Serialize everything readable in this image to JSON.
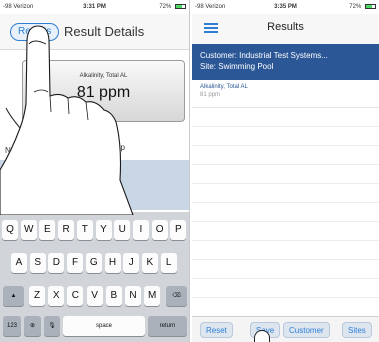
{
  "left": {
    "status": {
      "carrier": "-98 Verizon",
      "time": "3:31 PM",
      "battery": "72%",
      "battery_level": 0.72
    },
    "nav": {
      "back_label": "Results",
      "title": "Result Details"
    },
    "result": {
      "parameter": "Alkalinity, Total AL",
      "value": "81 ppm"
    },
    "input_method": "Input Method: iDip",
    "notes_label_fragment": "N",
    "keyboard": {
      "row1": [
        "Q",
        "W",
        "E",
        "R",
        "T",
        "Y",
        "U",
        "I",
        "O",
        "P"
      ],
      "row2": [
        "A",
        "S",
        "D",
        "F",
        "G",
        "H",
        "J",
        "K",
        "L"
      ],
      "row3": [
        "Z",
        "X",
        "C",
        "V",
        "B",
        "N",
        "M"
      ],
      "numbers_key": "123",
      "space_key": "space",
      "return_key": "return"
    }
  },
  "right": {
    "status": {
      "carrier": "-98 Verizon",
      "time": "3:35 PM",
      "battery": "72%",
      "battery_level": 0.72
    },
    "nav": {
      "title": "Results"
    },
    "customer": {
      "line1": "Customer: Industrial Test Systems...",
      "line2": "Site: Swimming Pool"
    },
    "item": {
      "name": "Alkalinity, Total AL",
      "value": "81 ppm"
    },
    "toolbar": {
      "reset": "Reset",
      "save": "Save",
      "customer": "Customer",
      "sites": "Sites"
    }
  },
  "colors": {
    "accent": "#2d7fd6",
    "header_blue": "#2b5797",
    "notes_bg": "#c8d6e6",
    "keyboard_bg": "#d1d4d9"
  }
}
